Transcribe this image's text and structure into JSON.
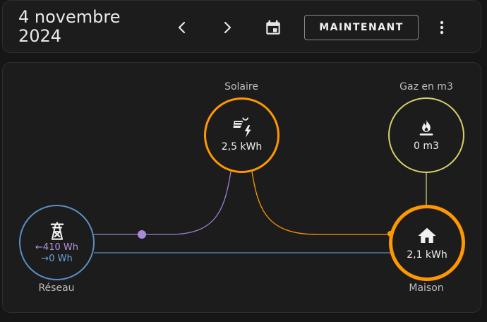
{
  "header": {
    "date": "4 novembre 2024",
    "now_label": "MAINTENANT"
  },
  "nodes": {
    "solar": {
      "label": "Solaire",
      "value": "2,5 kWh",
      "icon": "solar-power-icon"
    },
    "gas": {
      "label": "Gaz en m3",
      "value": "0 m3",
      "icon": "gas-flame-icon"
    },
    "grid": {
      "label": "Réseau",
      "import": "410 Wh",
      "export": "0 Wh",
      "icon": "transmission-tower-icon"
    },
    "home": {
      "label": "Maison",
      "value": "2,1 kWh",
      "icon": "home-icon"
    }
  },
  "colors": {
    "solar": "#ff9800",
    "gas": "#d6cf6c",
    "grid": "#5a8fc4",
    "grid_import": "#a88ad8",
    "home": "#ff9800",
    "flow_solar_grid": "#a27ed0"
  }
}
